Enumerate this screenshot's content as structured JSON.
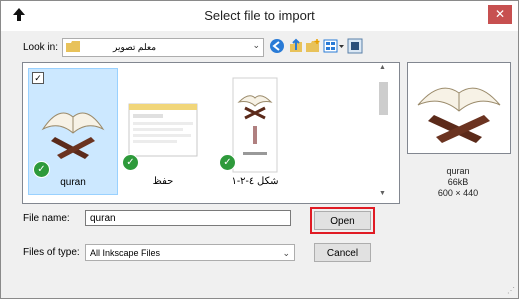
{
  "window": {
    "title": "Select file to import",
    "close_glyph": "✕"
  },
  "lookin": {
    "label": "Look in:",
    "value": "معلم تصویر"
  },
  "toolbar": {
    "icons": [
      "back-icon",
      "up-folder-icon",
      "new-folder-icon",
      "view-menu-icon",
      "preview-toggle-icon"
    ]
  },
  "files": [
    {
      "label": "quran",
      "selected": true,
      "checked": true
    },
    {
      "label": "حفظ",
      "selected": false,
      "checked": false
    },
    {
      "label": "شكل ٤-٢-١",
      "selected": false,
      "checked": false
    }
  ],
  "preview": {
    "name": "quran",
    "size": "66kB",
    "dims": "600 × 440"
  },
  "form": {
    "file_name_label": "File name:",
    "file_name_value": "quran",
    "files_of_type_label": "Files of type:",
    "files_of_type_value": "All Inkscape Files",
    "open_label": "Open",
    "cancel_label": "Cancel"
  },
  "colors": {
    "highlight": "#e01b24",
    "selection": "#cce8ff",
    "check_badge": "#2e9a3b"
  }
}
